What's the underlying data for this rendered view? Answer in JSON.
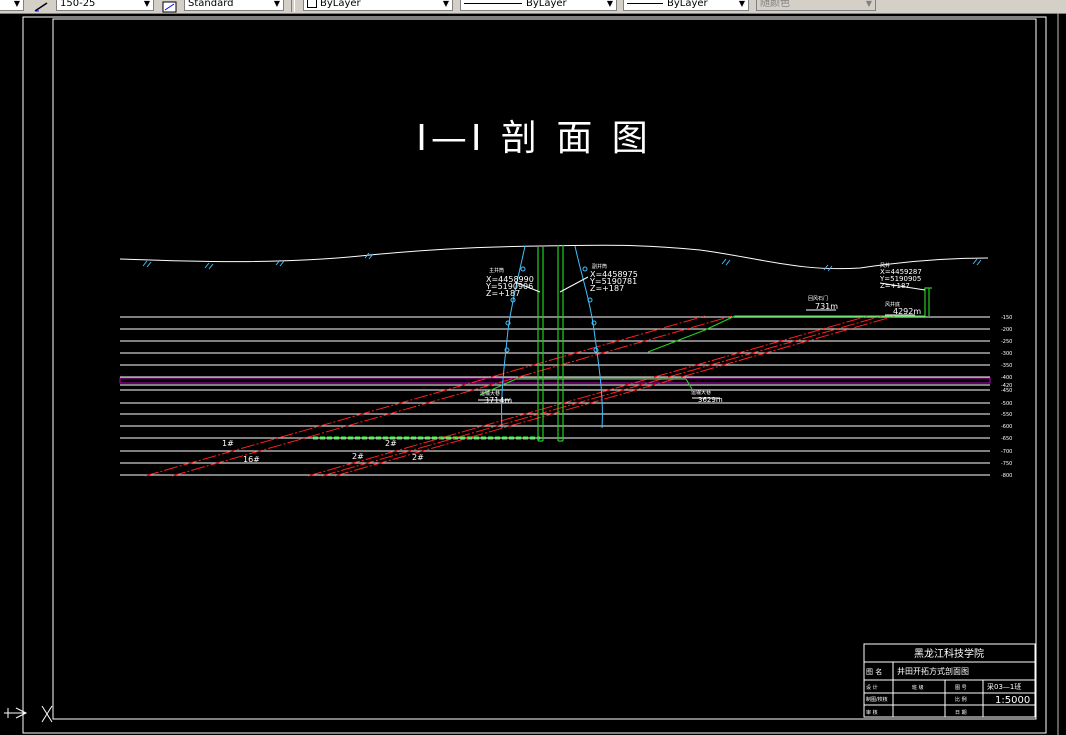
{
  "toolbar": {
    "dimstyle": "150-25",
    "tablestyle": "Standard",
    "layer": "ByLayer",
    "linetype": "ByLayer",
    "lineweight": "ByLayer",
    "plotstyle": "随颜色"
  },
  "drawing": {
    "title": "Ⅰ—Ⅰ 剖 面 图",
    "shaft_left": {
      "name": "主井筒",
      "coord_x": "X=4458990",
      "coord_y": "Y=5190906",
      "coord_z": "Z=+187"
    },
    "shaft_right": {
      "name": "副井筒",
      "coord_x": "X=4458975",
      "coord_y": "Y=5190781",
      "coord_z": "Z=+187"
    },
    "shaft_far": {
      "name": "风井",
      "coord_x": "X=4459287",
      "coord_y": "Y=5190905",
      "coord_z": "Z=+187"
    },
    "labels": {
      "level_left": "3714m",
      "level_right": "3629m",
      "incline_top": "731m",
      "incline_far": "4292m",
      "incline_top_name": "回风石门",
      "incline_far_name": "风井底",
      "level_left_name": "运输大巷",
      "level_right_name": "运输大巷",
      "seam_1": "1#",
      "seam_16": "16#",
      "seam_2a": "2#",
      "seam_2b": "2#",
      "seam_2c": "2#"
    },
    "elevations": [
      "-150",
      "-200",
      "-250",
      "-300",
      "-350",
      "-400",
      "-420",
      "-450",
      "-500",
      "-550",
      "-600",
      "-650",
      "-700",
      "-750",
      "-800"
    ]
  },
  "title_block": {
    "school": "黑龙江科技学院",
    "label_name": "图  名",
    "drawing_name": "井田开拓方式剖面图",
    "label_design": "设  计",
    "label_class": "班 级",
    "label_number": "图 号",
    "number_value": "采03—1班",
    "label_drawn": "制图/校核",
    "label_scale": "比 例",
    "scale_value": "1:5000",
    "label_review": "审  核",
    "label_date": "日 期"
  },
  "colors": {
    "background": "#000000",
    "white": "#ffffff",
    "red": "#ff2020",
    "green": "#20d020",
    "cyan": "#40c0ff",
    "magenta": "#c000c0"
  }
}
